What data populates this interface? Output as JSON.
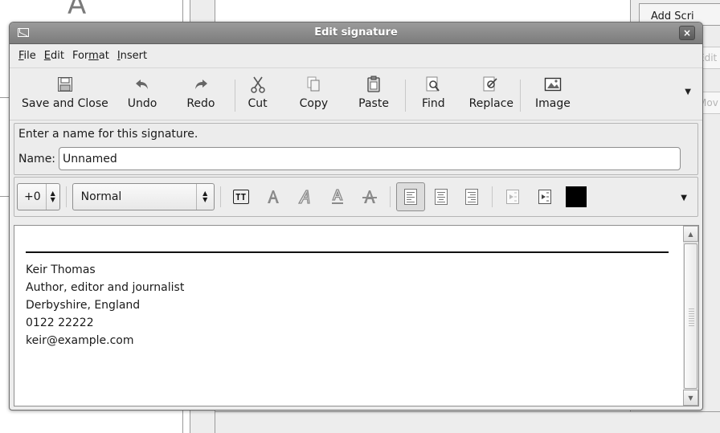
{
  "background": {
    "right_button_label": "Add Scri",
    "right_faded_1": "Edit",
    "right_faded_2": "Mov"
  },
  "dialog": {
    "title": "Edit signature",
    "close_glyph": "×"
  },
  "menubar": {
    "items": [
      {
        "prefix": "",
        "ul": "F",
        "rest": "ile"
      },
      {
        "prefix": "",
        "ul": "E",
        "rest": "dit"
      },
      {
        "prefix": "For",
        "ul": "m",
        "rest": "at"
      },
      {
        "prefix": "",
        "ul": "I",
        "rest": "nsert"
      }
    ]
  },
  "toolbar": {
    "save_close": "Save and Close",
    "undo": "Undo",
    "redo": "Redo",
    "cut": "Cut",
    "copy": "Copy",
    "paste": "Paste",
    "find": "Find",
    "replace": "Replace",
    "image": "Image",
    "more_glyph": "▼"
  },
  "name_section": {
    "prompt": "Enter a name for this signature.",
    "label": "Name:",
    "value": "Unnamed"
  },
  "format_bar": {
    "font_size_value": "+0",
    "paragraph_style": "Normal",
    "tt_label": "TT",
    "more_glyph": "▼",
    "text_color": "#000000"
  },
  "signature": {
    "lines": [
      "Keir Thomas",
      "Author, editor and journalist",
      "Derbyshire, England",
      "0122 22222",
      "keir@example.com"
    ]
  }
}
